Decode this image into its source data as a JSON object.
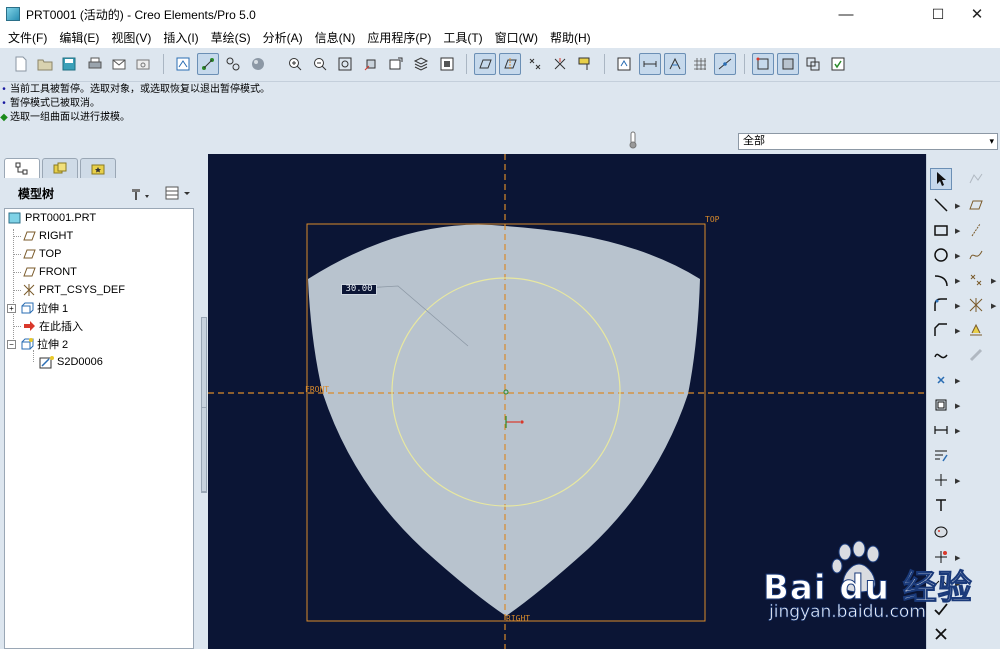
{
  "window": {
    "title": "PRT0001 (活动的) - Creo Elements/Pro 5.0",
    "minimize_glyph": "—",
    "maximize_glyph": "☐",
    "close_glyph": "✕"
  },
  "menubar": {
    "items": [
      {
        "label": "文件(F)"
      },
      {
        "label": "编辑(E)"
      },
      {
        "label": "视图(V)"
      },
      {
        "label": "插入(I)"
      },
      {
        "label": "草绘(S)"
      },
      {
        "label": "分析(A)"
      },
      {
        "label": "信息(N)"
      },
      {
        "label": "应用程序(P)"
      },
      {
        "label": "工具(T)"
      },
      {
        "label": "窗口(W)"
      },
      {
        "label": "帮助(H)"
      }
    ]
  },
  "messages": {
    "lines": [
      {
        "text": "当前工具被暂停。选取对象，或选取恢复以退出暂停模式。",
        "bullet": "•",
        "color": "#1a1aa0"
      },
      {
        "text": "暂停模式已被取消。",
        "bullet": "•",
        "color": "#1a1aa0"
      },
      {
        "text": "选取一组曲面以进行拔模。",
        "bullet": "◆",
        "color": "#1a8a1a"
      }
    ]
  },
  "filter": {
    "selected": "全部",
    "arrow": "▾"
  },
  "model_tree": {
    "header_label": "模型树",
    "items": [
      {
        "label": "PRT0001.PRT",
        "icon": "part-icon"
      },
      {
        "label": "RIGHT",
        "icon": "datum-plane-icon"
      },
      {
        "label": "TOP",
        "icon": "datum-plane-icon"
      },
      {
        "label": "FRONT",
        "icon": "datum-plane-icon"
      },
      {
        "label": "PRT_CSYS_DEF",
        "icon": "csys-icon"
      },
      {
        "label": "拉伸 1",
        "icon": "extrude-icon"
      },
      {
        "label": "在此插入",
        "icon": "insert-here-arrow-icon"
      },
      {
        "label": "拉伸 2",
        "icon": "extrude-icon"
      },
      {
        "label": "S2D0006",
        "icon": "sketch-icon"
      }
    ]
  },
  "graphics": {
    "background_color": "#0b1535",
    "datum_labels": {
      "top": "TOP",
      "front": "FRONT",
      "right": "RIGHT"
    },
    "dimension_value": "30.00"
  },
  "watermark": {
    "brand": "Bai du 经验",
    "url": "jingyan.baidu.com"
  },
  "colors": {
    "datum_orange": "#d98a2b",
    "sketch_yellow": "#e8e8a0",
    "part_fill": "#b8c3ce",
    "accent_blue": "#2a6db3"
  }
}
